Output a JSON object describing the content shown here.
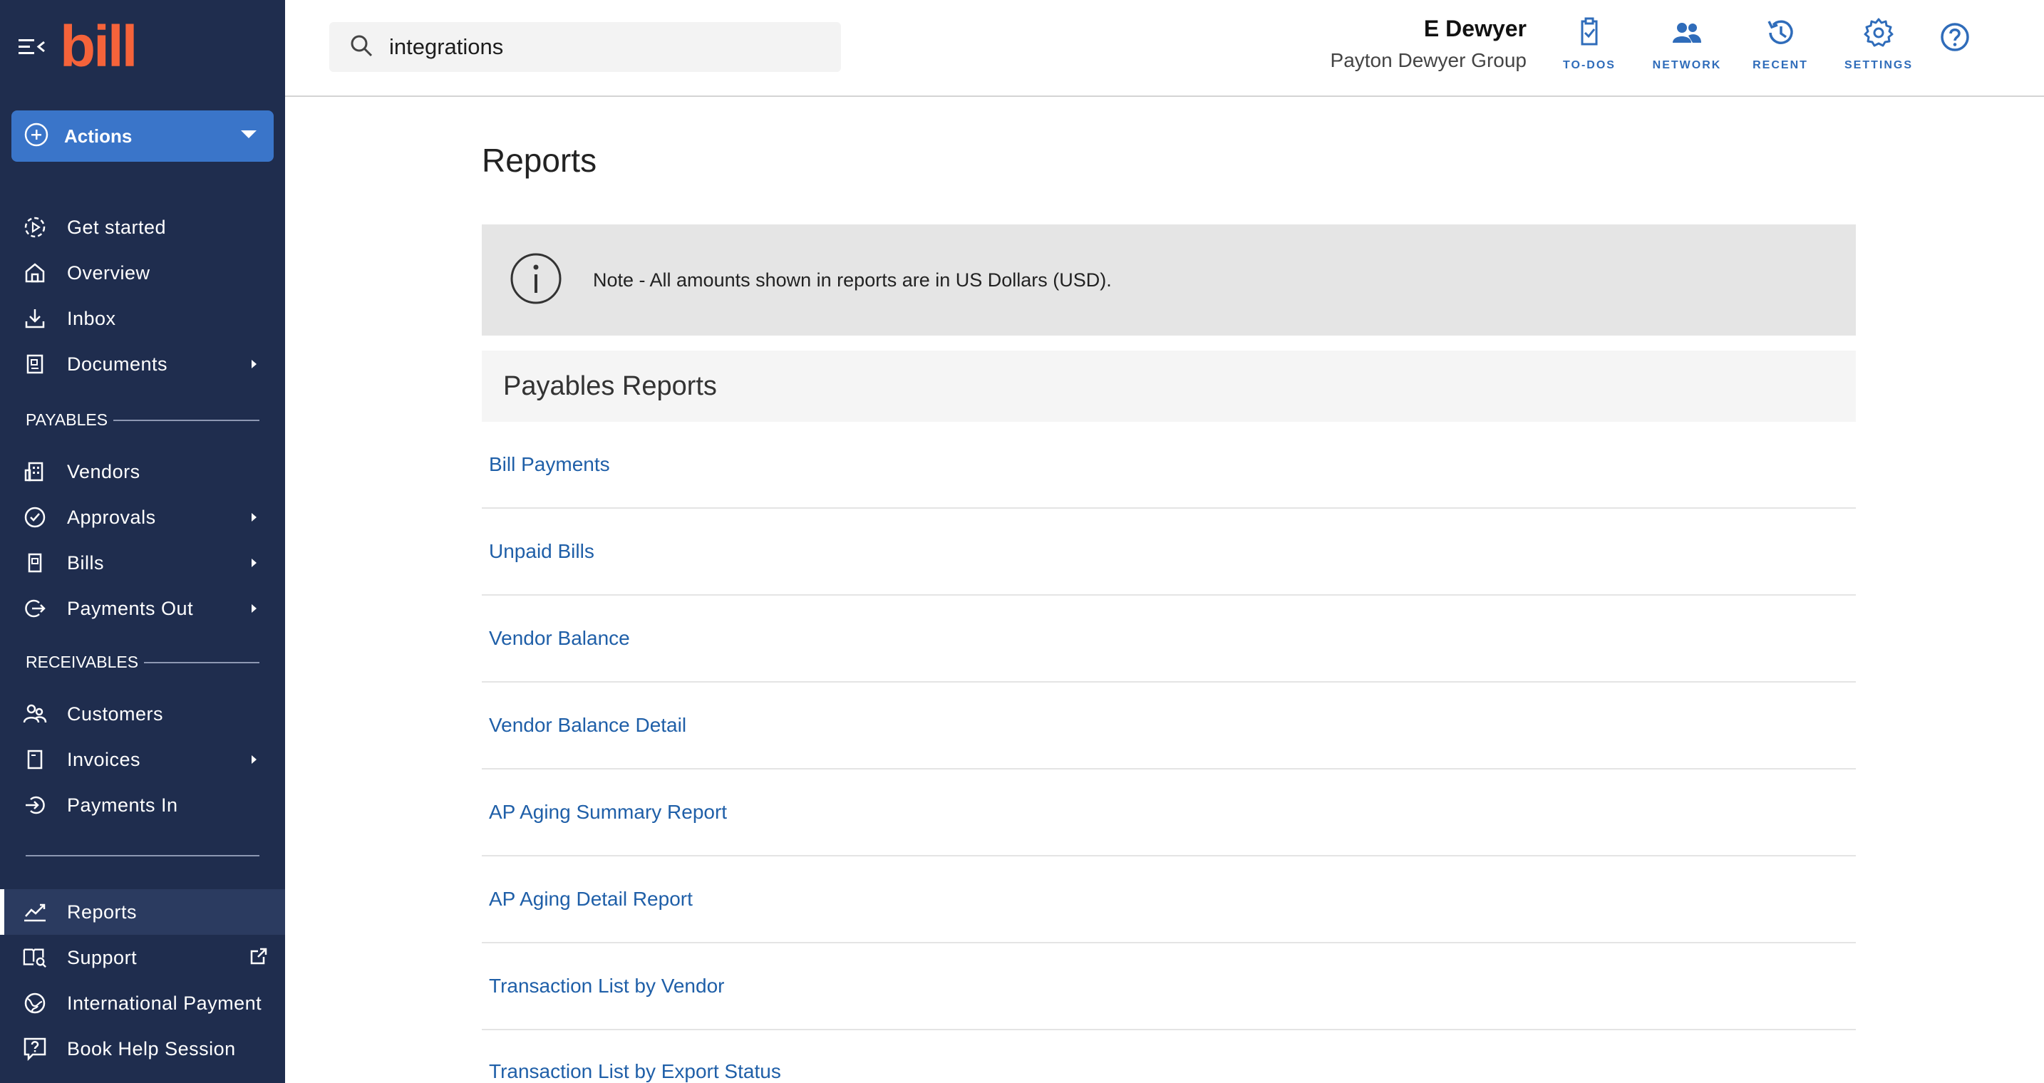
{
  "sidebar": {
    "logo": "bill",
    "actions_label": "Actions",
    "items": [
      {
        "label": "Get started",
        "icon": "get-started-icon"
      },
      {
        "label": "Overview",
        "icon": "home-icon"
      },
      {
        "label": "Inbox",
        "icon": "inbox-icon"
      },
      {
        "label": "Documents",
        "icon": "documents-icon"
      },
      {
        "label": "Vendors",
        "icon": "vendors-icon"
      },
      {
        "label": "Approvals",
        "icon": "approvals-icon"
      },
      {
        "label": "Bills",
        "icon": "bills-icon"
      },
      {
        "label": "Payments Out",
        "icon": "payments-out-icon"
      },
      {
        "label": "Customers",
        "icon": "customers-icon"
      },
      {
        "label": "Invoices",
        "icon": "invoices-icon"
      },
      {
        "label": "Payments In",
        "icon": "payments-in-icon"
      },
      {
        "label": "Reports",
        "icon": "reports-icon"
      },
      {
        "label": "Support",
        "icon": "support-icon"
      },
      {
        "label": "International Payment",
        "icon": "globe-icon"
      },
      {
        "label": "Book Help Session",
        "icon": "help-session-icon"
      }
    ],
    "sections": {
      "payables": "PAYABLES",
      "receivables": "RECEIVABLES"
    }
  },
  "header": {
    "search_value": "integrations",
    "user_name": "E Dewyer",
    "org_name": "Payton Dewyer Group",
    "buttons": [
      {
        "label": "TO-DOS",
        "icon": "todo-icon"
      },
      {
        "label": "NETWORK",
        "icon": "network-icon"
      },
      {
        "label": "RECENT",
        "icon": "history-icon"
      },
      {
        "label": "SETTINGS",
        "icon": "gear-icon"
      }
    ]
  },
  "main": {
    "title": "Reports",
    "note": "Note - All amounts shown in reports are in US Dollars (USD).",
    "section_title": "Payables Reports",
    "reports": [
      "Bill Payments",
      "Unpaid Bills",
      "Vendor Balance",
      "Vendor Balance Detail",
      "AP Aging Summary Report",
      "AP Aging Detail Report",
      "Transaction List by Vendor",
      "Transaction List by Export Status"
    ]
  },
  "colors": {
    "sidebar_bg": "#1f2d4e",
    "accent": "#3a75c9",
    "brand": "#f5633a",
    "link": "#1f5fa8"
  }
}
